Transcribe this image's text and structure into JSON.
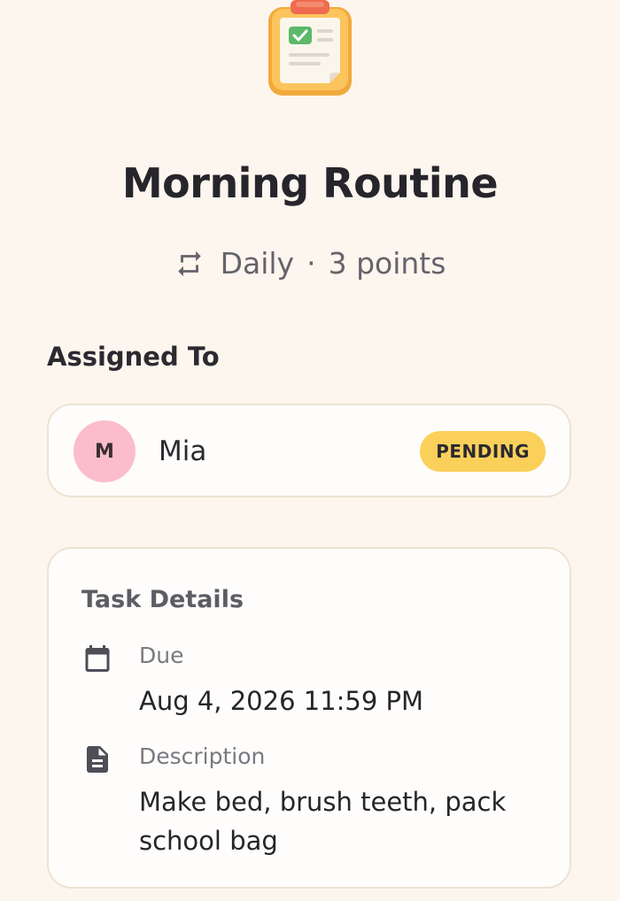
{
  "icons": {
    "hero": "clipboard-check-icon",
    "frequency": "repeat-icon",
    "due": "calendar-icon",
    "description": "document-icon"
  },
  "colors": {
    "background": "#fdf6ee",
    "avatar": "#fbbdcb",
    "status_pending": "#fbd05a",
    "card_border": "#ece3d3"
  },
  "task": {
    "title": "Morning Routine",
    "frequency": "Daily",
    "separator": "·",
    "points": "3 points"
  },
  "assigned": {
    "heading": "Assigned To",
    "avatar_initial": "M",
    "name": "Mia",
    "status": "PENDING"
  },
  "details": {
    "heading": "Task Details",
    "due_label": "Due",
    "due_value": "Aug 4, 2026 11:59 PM",
    "description_label": "Description",
    "description_value": "Make bed, brush teeth, pack school bag"
  }
}
